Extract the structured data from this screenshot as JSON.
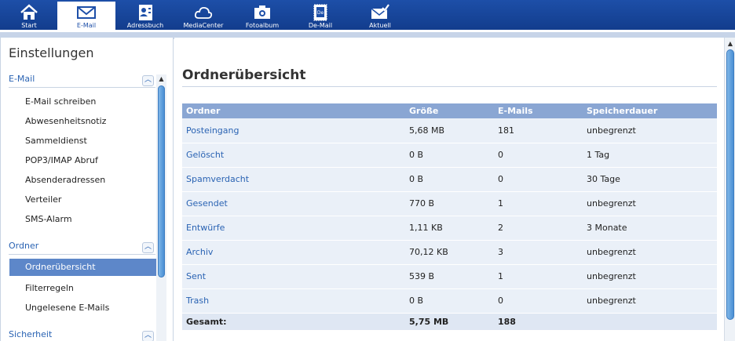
{
  "nav": {
    "items": [
      {
        "label": "Start",
        "icon": "home-icon"
      },
      {
        "label": "E-Mail",
        "icon": "envelope-icon"
      },
      {
        "label": "Adressbuch",
        "icon": "address-book-icon"
      },
      {
        "label": "MediaCenter",
        "icon": "cloud-icon"
      },
      {
        "label": "Fotoalbum",
        "icon": "camera-icon"
      },
      {
        "label": "De-Mail",
        "icon": "stamp-icon"
      },
      {
        "label": "Aktuell",
        "icon": "news-envelope-icon"
      }
    ],
    "active": "E-Mail"
  },
  "sidebar": {
    "heading": "Einstellungen",
    "sections": [
      {
        "title": "E-Mail",
        "items": [
          "E-Mail schreiben",
          "Abwesenheitsnotiz",
          "Sammeldienst",
          "POP3/IMAP Abruf",
          "Absenderadressen",
          "Verteiler",
          "SMS-Alarm"
        ]
      },
      {
        "title": "Ordner",
        "items": [
          "Ordnerübersicht",
          "Filterregeln",
          "Ungelesene E-Mails"
        ]
      },
      {
        "title": "Sicherheit",
        "items": []
      }
    ],
    "active_item": "Ordnerübersicht"
  },
  "main": {
    "title": "Ordnerübersicht",
    "columns": [
      "Ordner",
      "Größe",
      "E-Mails",
      "Speicherdauer"
    ],
    "rows": [
      {
        "name": "Posteingang",
        "size": "5,68 MB",
        "count": "181",
        "retention": "unbegrenzt"
      },
      {
        "name": "Gelöscht",
        "size": "0 B",
        "count": "0",
        "retention": "1 Tag"
      },
      {
        "name": "Spamverdacht",
        "size": "0 B",
        "count": "0",
        "retention": "30 Tage"
      },
      {
        "name": "Gesendet",
        "size": "770 B",
        "count": "1",
        "retention": "unbegrenzt"
      },
      {
        "name": "Entwürfe",
        "size": "1,11 KB",
        "count": "2",
        "retention": "3 Monate"
      },
      {
        "name": "Archiv",
        "size": "70,12 KB",
        "count": "3",
        "retention": "unbegrenzt"
      },
      {
        "name": "Sent",
        "size": "539 B",
        "count": "1",
        "retention": "unbegrenzt"
      },
      {
        "name": "Trash",
        "size": "0 B",
        "count": "0",
        "retention": "unbegrenzt"
      }
    ],
    "total": {
      "label": "Gesamt:",
      "size": "5,75 MB",
      "count": "188"
    }
  },
  "colors": {
    "brand_blue": "#1d4fa8",
    "link_blue": "#2a63b3",
    "header_row": "#8aa6d3",
    "row_bg": "#eaf0f8",
    "active_item": "#5d87c9"
  }
}
